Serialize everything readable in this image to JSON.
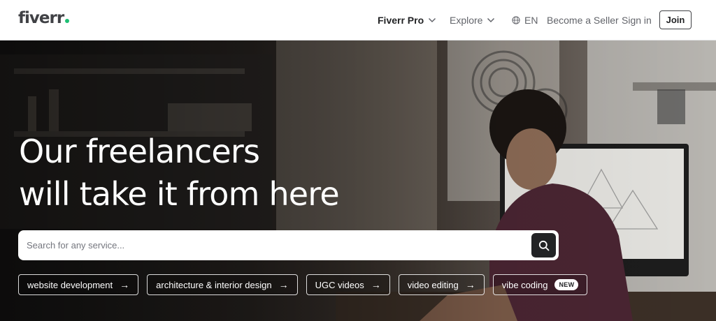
{
  "header": {
    "logo_text": "fiverr",
    "nav": {
      "fiverr_pro": "Fiverr Pro",
      "explore": "Explore",
      "language": "EN",
      "become_seller": "Become a Seller",
      "sign_in": "Sign in",
      "join": "Join"
    }
  },
  "hero": {
    "headline_line1": "Our freelancers",
    "headline_line2": "will take it from here",
    "search": {
      "placeholder": "Search for any service...",
      "value": ""
    },
    "chips": [
      {
        "label": "website development"
      },
      {
        "label": "architecture & interior design"
      },
      {
        "label": "UGC videos"
      },
      {
        "label": "video editing"
      },
      {
        "label": "vibe coding",
        "badge": "NEW"
      }
    ]
  },
  "colors": {
    "brand_green": "#1dbf73",
    "text_dark": "#404145",
    "search_button": "#222325"
  },
  "icons": {
    "search": "magnifier-icon",
    "globe": "globe-icon",
    "chevron": "chevron-down-icon",
    "arrow": "arrow-right-icon"
  }
}
